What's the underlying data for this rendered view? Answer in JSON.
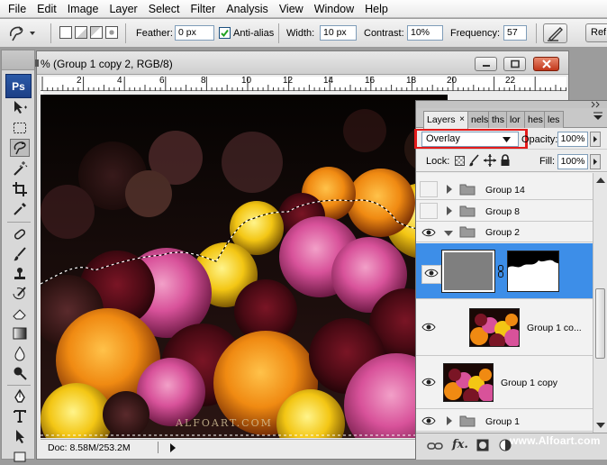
{
  "menu": [
    "File",
    "Edit",
    "Image",
    "Layer",
    "Select",
    "Filter",
    "Analysis",
    "View",
    "Window",
    "Help"
  ],
  "options": {
    "feather_label": "Feather:",
    "feather_value": "0 px",
    "antialias_label": "Anti-alias",
    "antialias_checked": true,
    "width_label": "Width:",
    "width_value": "10 px",
    "contrast_label": "Contrast:",
    "contrast_value": "10%",
    "frequency_label": "Frequency:",
    "frequency_value": "57",
    "refine_label": "Ref"
  },
  "toolbox": {
    "logo": "Ps"
  },
  "document": {
    "title": "% (Group 1 copy 2, RGB/8)",
    "ruler_ticks": [
      "2",
      "4",
      "6",
      "8",
      "10",
      "12",
      "14",
      "16",
      "18",
      "20",
      "22"
    ],
    "canvas_watermark": "ALFOART.COM",
    "status": "Doc: 8.58M/253.2M"
  },
  "layers_panel": {
    "tabs": [
      {
        "label": "Layers",
        "active": true
      },
      {
        "label": "nels",
        "active": false
      },
      {
        "label": "ths",
        "active": false
      },
      {
        "label": "lor",
        "active": false
      },
      {
        "label": "hes",
        "active": false
      },
      {
        "label": "les",
        "active": false
      }
    ],
    "blend_mode": "Overlay",
    "opacity_label": "Opacity:",
    "opacity_value": "100%",
    "lock_label": "Lock:",
    "fill_label": "Fill:",
    "fill_value": "100%",
    "layers": [
      {
        "name": "Group 14",
        "type": "group",
        "visible": false,
        "expanded": false
      },
      {
        "name": "Group 8",
        "type": "group",
        "visible": false,
        "expanded": false
      },
      {
        "name": "Group 2",
        "type": "group",
        "visible": true,
        "expanded": true
      },
      {
        "name": "",
        "type": "adjustment-mask",
        "visible": true,
        "selected": true
      },
      {
        "name": "Group 1 co...",
        "type": "image",
        "visible": true
      },
      {
        "name": "Group 1 copy",
        "type": "image",
        "visible": true
      },
      {
        "name": "Group 1",
        "type": "group",
        "visible": true,
        "expanded": false
      }
    ]
  },
  "watermark": "www.Alfoart.com",
  "colors": {
    "selection": "#3d8ee8",
    "highlight_red": "#e31b1b",
    "ps_blue": "#2b5aa8"
  }
}
